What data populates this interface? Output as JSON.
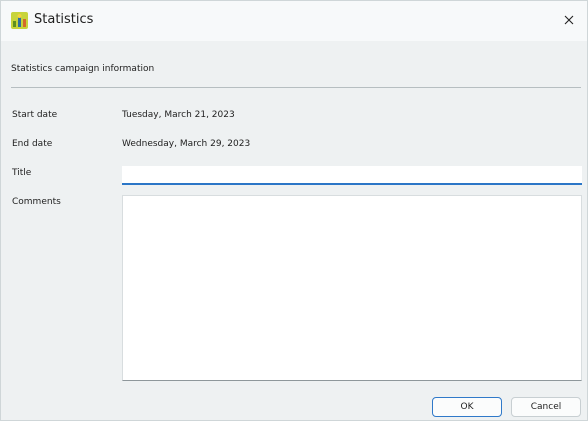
{
  "window": {
    "title": "Statistics",
    "icon": "statistics-app-icon",
    "close_icon": "close-icon"
  },
  "section": {
    "label": "Statistics campaign information"
  },
  "fields": {
    "start_date": {
      "label": "Start date",
      "value": "Tuesday, March 21, 2023"
    },
    "end_date": {
      "label": "End date",
      "value": "Wednesday, March 29, 2023"
    },
    "title": {
      "label": "Title",
      "value": ""
    },
    "comments": {
      "label": "Comments",
      "value": ""
    }
  },
  "buttons": {
    "ok": "OK",
    "cancel": "Cancel"
  },
  "colors": {
    "accent": "#2b76c7",
    "window_bg": "#eef1f2",
    "titlebar_bg": "#f7f9fa"
  }
}
